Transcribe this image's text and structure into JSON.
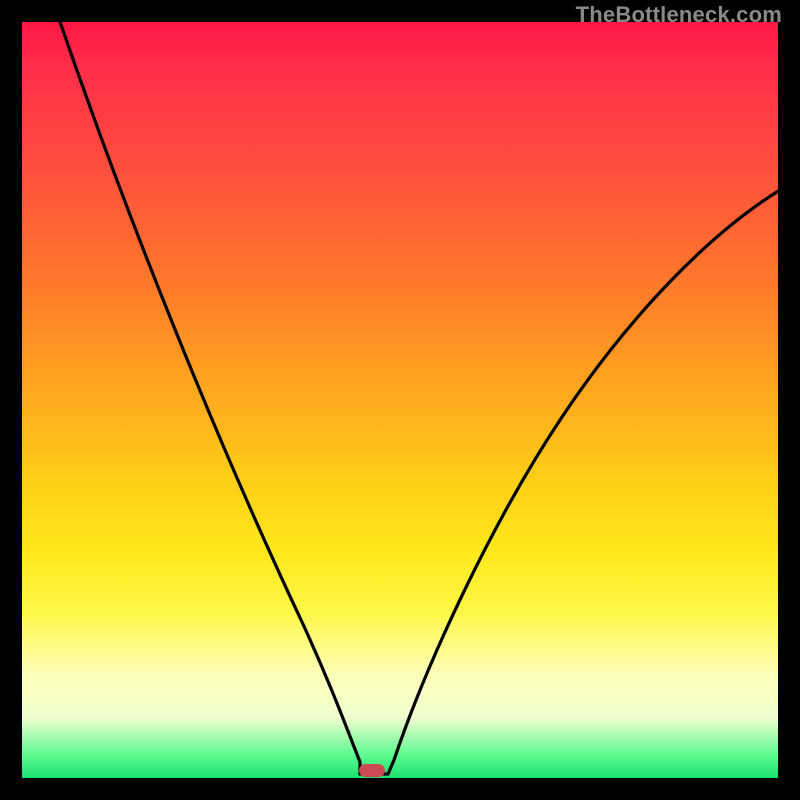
{
  "watermark": "TheBottleneck.com",
  "chart_data": {
    "type": "line",
    "title": "",
    "xlabel": "",
    "ylabel": "",
    "xlim": [
      0,
      100
    ],
    "ylim": [
      0,
      100
    ],
    "grid": false,
    "legend": false,
    "min_point": {
      "x": 46,
      "y": 0
    },
    "series": [
      {
        "name": "left-branch",
        "x": [
          5,
          10,
          15,
          20,
          25,
          30,
          35,
          40,
          43,
          45
        ],
        "values": [
          100,
          82,
          66,
          52,
          40,
          29,
          19,
          10,
          4,
          1
        ]
      },
      {
        "name": "right-branch",
        "x": [
          48,
          50,
          55,
          60,
          65,
          70,
          75,
          80,
          85,
          90,
          95,
          100
        ],
        "values": [
          1,
          5,
          15,
          25,
          34,
          42,
          50,
          57,
          63,
          69,
          74,
          78
        ]
      }
    ],
    "marker": {
      "x": 46,
      "y": 0,
      "color": "#cc4b52"
    }
  },
  "colors": {
    "gradient_top": "#ff1744",
    "gradient_mid": "#ffe81a",
    "gradient_bottom": "#18e070",
    "curve": "#000000",
    "frame": "#000000",
    "marker": "#cc4b52"
  }
}
